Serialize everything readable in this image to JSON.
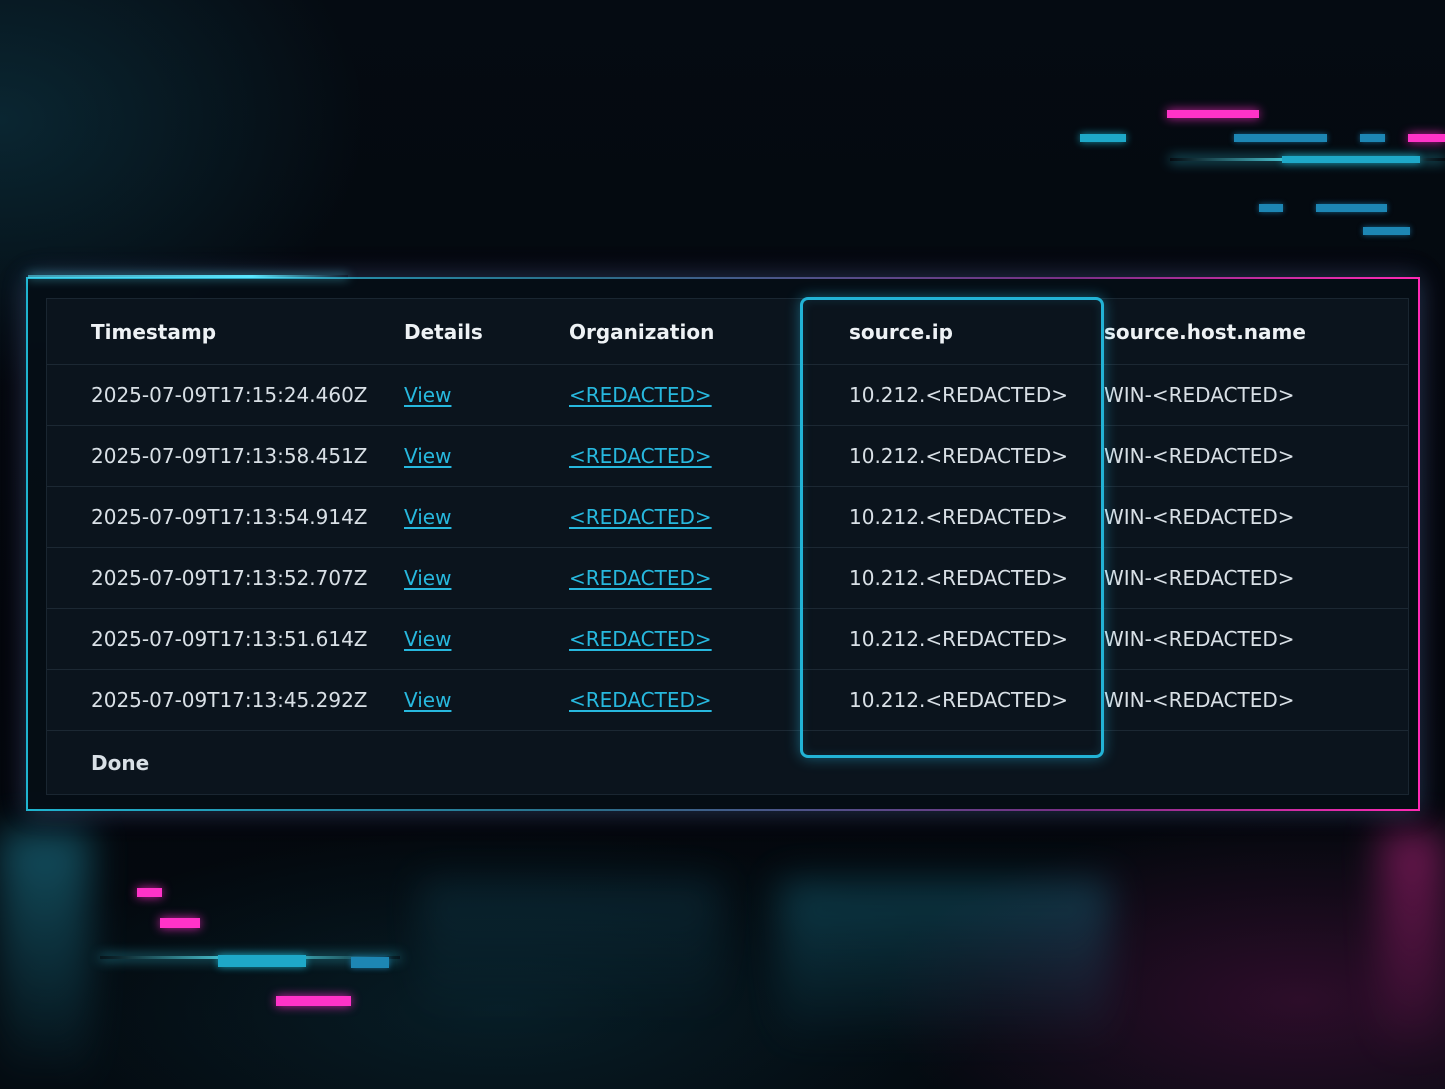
{
  "table": {
    "columns": [
      "Timestamp",
      "Details",
      "Organization",
      "source.ip",
      "source.host.name"
    ],
    "rows": [
      {
        "timestamp": "2025-07-09T17:15:24.460Z",
        "details": "View",
        "organization": "<REDACTED>",
        "source_ip": "10.212.<REDACTED>",
        "host_name": "WIN-<REDACTED>"
      },
      {
        "timestamp": "2025-07-09T17:13:58.451Z",
        "details": "View",
        "organization": "<REDACTED>",
        "source_ip": "10.212.<REDACTED>",
        "host_name": "WIN-<REDACTED>"
      },
      {
        "timestamp": "2025-07-09T17:13:54.914Z",
        "details": "View",
        "organization": "<REDACTED>",
        "source_ip": "10.212.<REDACTED>",
        "host_name": "WIN-<REDACTED>"
      },
      {
        "timestamp": "2025-07-09T17:13:52.707Z",
        "details": "View",
        "organization": "<REDACTED>",
        "source_ip": "10.212.<REDACTED>",
        "host_name": "WIN-<REDACTED>"
      },
      {
        "timestamp": "2025-07-09T17:13:51.614Z",
        "details": "View",
        "organization": "<REDACTED>",
        "source_ip": "10.212.<REDACTED>",
        "host_name": "WIN-<REDACTED>"
      },
      {
        "timestamp": "2025-07-09T17:13:45.292Z",
        "details": "View",
        "organization": "<REDACTED>",
        "source_ip": "10.212.<REDACTED>",
        "host_name": "WIN-<REDACTED>"
      }
    ],
    "footer": "Done",
    "highlighted_column": "source.ip"
  },
  "colors": {
    "accent_cyan": "#22b3d6",
    "accent_pink": "#ff33c8",
    "link": "#27b8de",
    "background": "#03070c"
  }
}
